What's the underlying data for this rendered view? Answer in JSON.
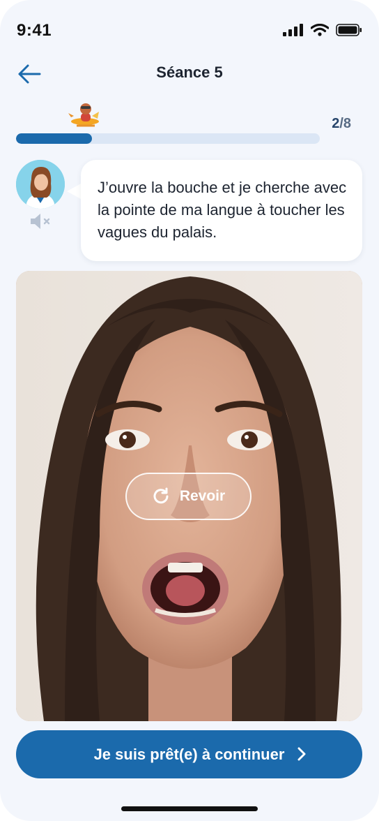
{
  "status_bar": {
    "time": "9:41"
  },
  "header": {
    "title": "Séance 5"
  },
  "progress": {
    "current": "2",
    "separator": "/",
    "total": "8",
    "fraction": 0.25
  },
  "tutor": {
    "message": "J’ouvre la bouche et je cherche avec la pointe de ma langue à toucher les vagues du palais."
  },
  "video": {
    "replay_label": "Revoir"
  },
  "cta": {
    "continue_label": "Je suis prêt(e) à continuer"
  },
  "colors": {
    "primary": "#1b6aac",
    "track": "#dbe6f5",
    "background": "#f3f6fc"
  }
}
